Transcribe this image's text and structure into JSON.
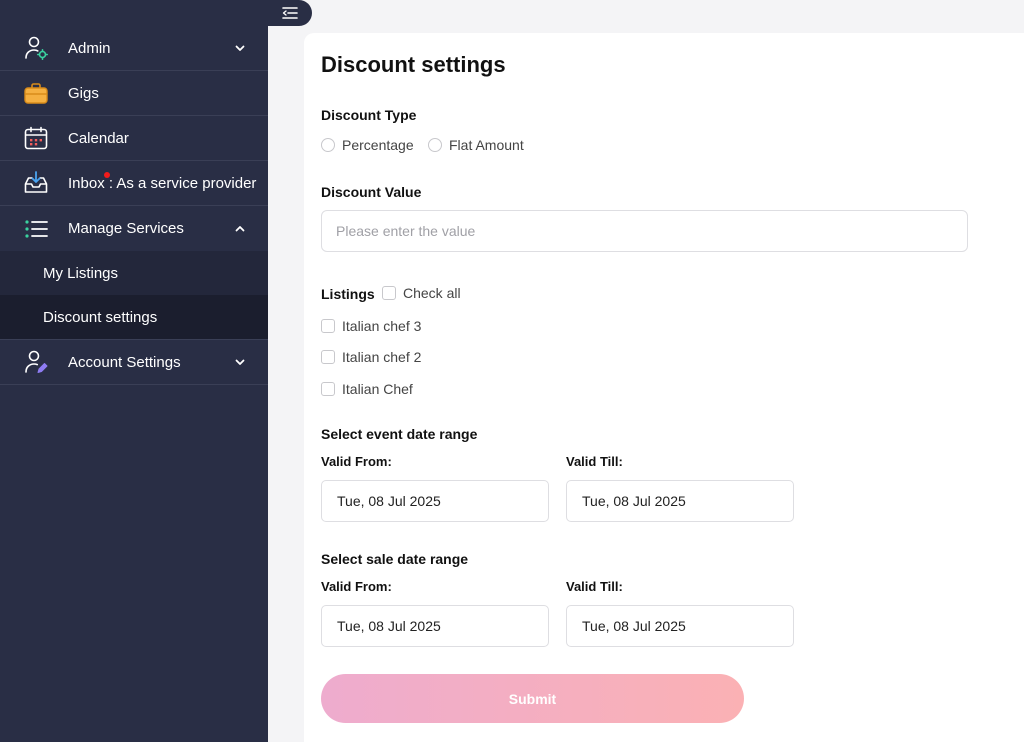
{
  "sidebar": {
    "items": [
      {
        "label": "Admin",
        "icon": "user-gear-icon"
      },
      {
        "label": "Gigs",
        "icon": "briefcase-icon"
      },
      {
        "label": "Calendar",
        "icon": "calendar-icon"
      },
      {
        "label": "Inbox : As a service provider",
        "icon": "inbox-icon"
      },
      {
        "label": "Manage Services",
        "icon": "list-icon"
      },
      {
        "label": "Account Settings",
        "icon": "user-edit-icon"
      }
    ],
    "sub_items": [
      {
        "label": "My Listings"
      },
      {
        "label": "Discount settings",
        "active": true
      }
    ]
  },
  "page": {
    "title": "Discount settings",
    "discount_type": {
      "label": "Discount Type",
      "options": [
        "Percentage",
        "Flat Amount"
      ]
    },
    "discount_value": {
      "label": "Discount Value",
      "placeholder": "Please enter the value",
      "value": ""
    },
    "listings": {
      "label": "Listings",
      "check_all": "Check all",
      "items": [
        "Italian chef 3",
        "Italian chef 2",
        "Italian Chef"
      ]
    },
    "event_range": {
      "label": "Select event date range",
      "from_label": "Valid From:",
      "till_label": "Valid Till:",
      "from": "Tue, 08 Jul 2025",
      "till": "Tue, 08 Jul 2025"
    },
    "sale_range": {
      "label": "Select sale date range",
      "from_label": "Valid From:",
      "till_label": "Valid Till:",
      "from": "Tue, 08 Jul 2025",
      "till": "Tue, 08 Jul 2025"
    },
    "submit_label": "Submit"
  },
  "colors": {
    "sidebar_bg": "#292e45",
    "accent_pink": "#eeacce",
    "accent_salmon": "#fbb1b4",
    "notification": "#f21b1b"
  }
}
